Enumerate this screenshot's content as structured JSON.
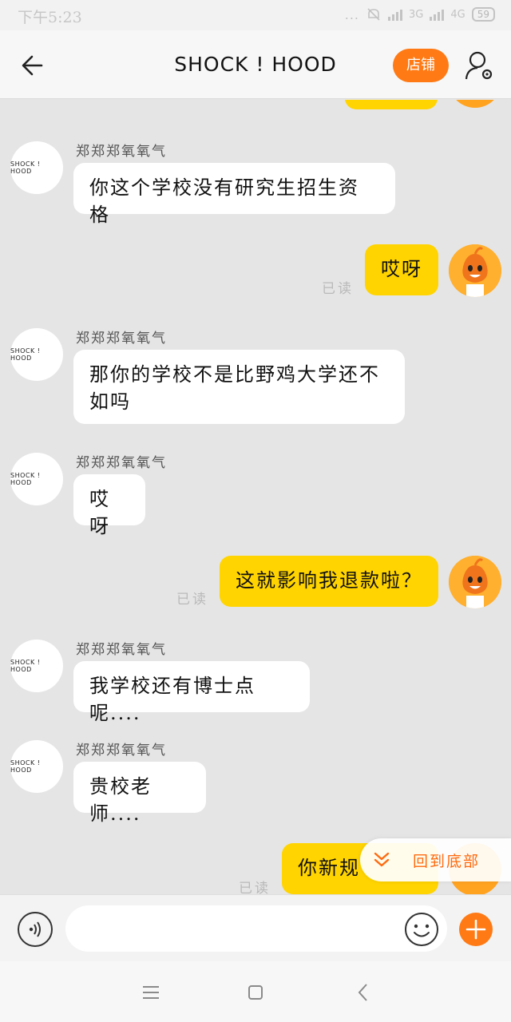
{
  "status_bar": {
    "time": "下午5:23",
    "dots": "...",
    "network_1": "3G",
    "network_2": "4G",
    "battery": "59"
  },
  "header": {
    "title": "SHOCK ! HOOD",
    "shop_label": "店铺"
  },
  "shop": {
    "avatar_text": "SHOCK ! HOOD"
  },
  "messages": [
    {
      "side": "in",
      "sender": "郑郑郑氧氧气",
      "text": "你这个学校没有研究生招生资格"
    },
    {
      "side": "out",
      "text": "哎呀",
      "status": "已读"
    },
    {
      "side": "in",
      "sender": "郑郑郑氧氧气",
      "text_line1": "那你的学校不是比野鸡大学还不",
      "text_line2": "如吗"
    },
    {
      "side": "in",
      "sender": "郑郑郑氧氧气",
      "text": "哎呀"
    },
    {
      "side": "out",
      "text": "这就影响我退款啦？",
      "status": "已读"
    },
    {
      "side": "in",
      "sender": "郑郑郑氧氧气",
      "text": "我学校还有博士点呢...."
    },
    {
      "side": "in",
      "sender": "郑郑郑氧氧气",
      "text": "贵校老师...."
    },
    {
      "side": "out",
      "text": "你新规",
      "status": "已读"
    }
  ],
  "scroll_to_bottom": {
    "label": "回到底部"
  },
  "input": {
    "placeholder": ""
  },
  "colors": {
    "accent": "#ff7a14",
    "bubble_out": "#ffd400",
    "bubble_in": "#ffffff",
    "background": "#e5e5e5"
  },
  "icons": {
    "back": "arrow-left-icon",
    "profile": "user-settings-icon",
    "voice": "voice-icon",
    "emoji": "smiley-icon",
    "plus": "plus-icon",
    "scroll": "double-chevron-down-icon",
    "nav_menu": "menu-icon",
    "nav_home": "square-icon",
    "nav_back": "chevron-left-icon"
  }
}
